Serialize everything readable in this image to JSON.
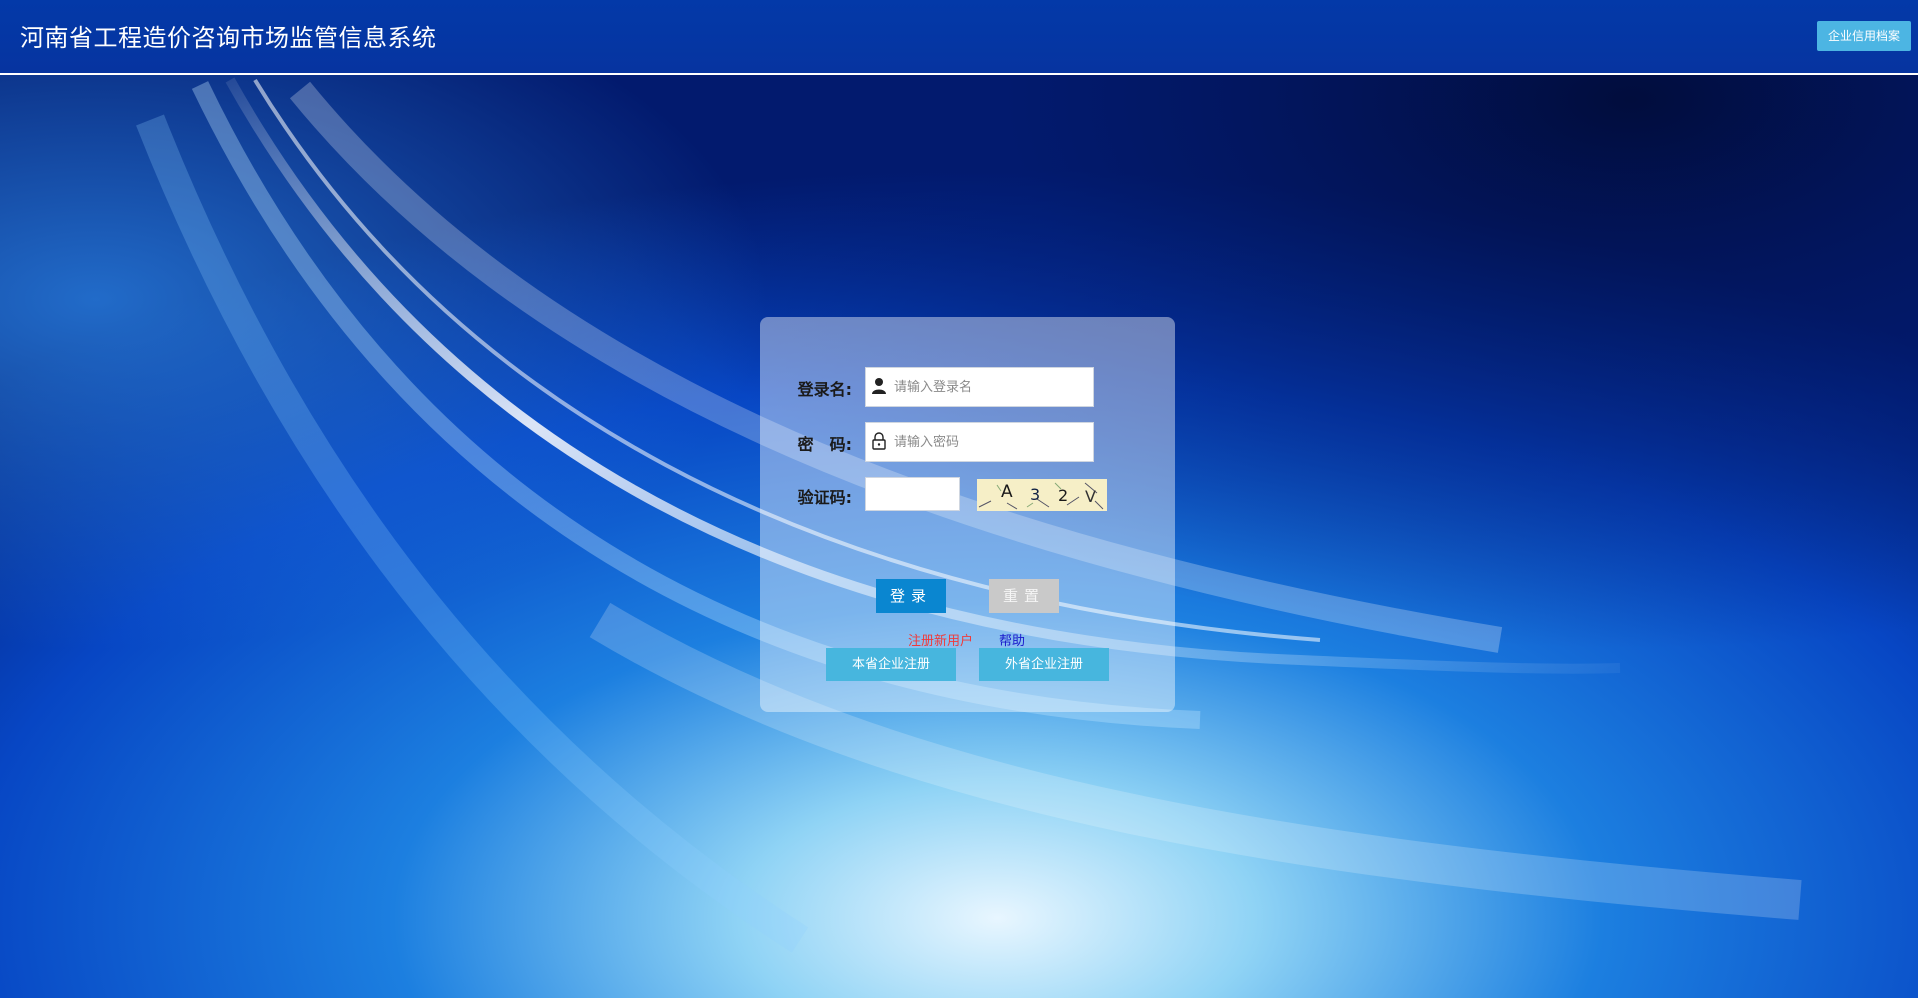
{
  "header": {
    "title": "河南省工程造价咨询市场监管信息系统",
    "credit_button": "企业信用档案"
  },
  "login": {
    "username_label": "登录名:",
    "username_placeholder": "请输入登录名",
    "password_label": "密　码:",
    "password_placeholder": "请输入密码",
    "captcha_label": "验证码:",
    "captcha_chars": [
      "A",
      "3",
      "2",
      "V"
    ],
    "login_button": "登录",
    "reset_button": "重置",
    "register_link": "注册新用户",
    "help_link": "帮助",
    "local_register_button": "本省企业注册",
    "outside_register_button": "外省企业注册"
  },
  "colors": {
    "header_bg": "#0339a8",
    "login_button": "#0a86d0",
    "reset_button": "#c9c9c9",
    "register_buttons": "#47b6de",
    "register_link": "#f03a3a",
    "help_link": "#1a1acc"
  },
  "icons": {
    "username": "user-icon",
    "password": "lock-icon"
  }
}
